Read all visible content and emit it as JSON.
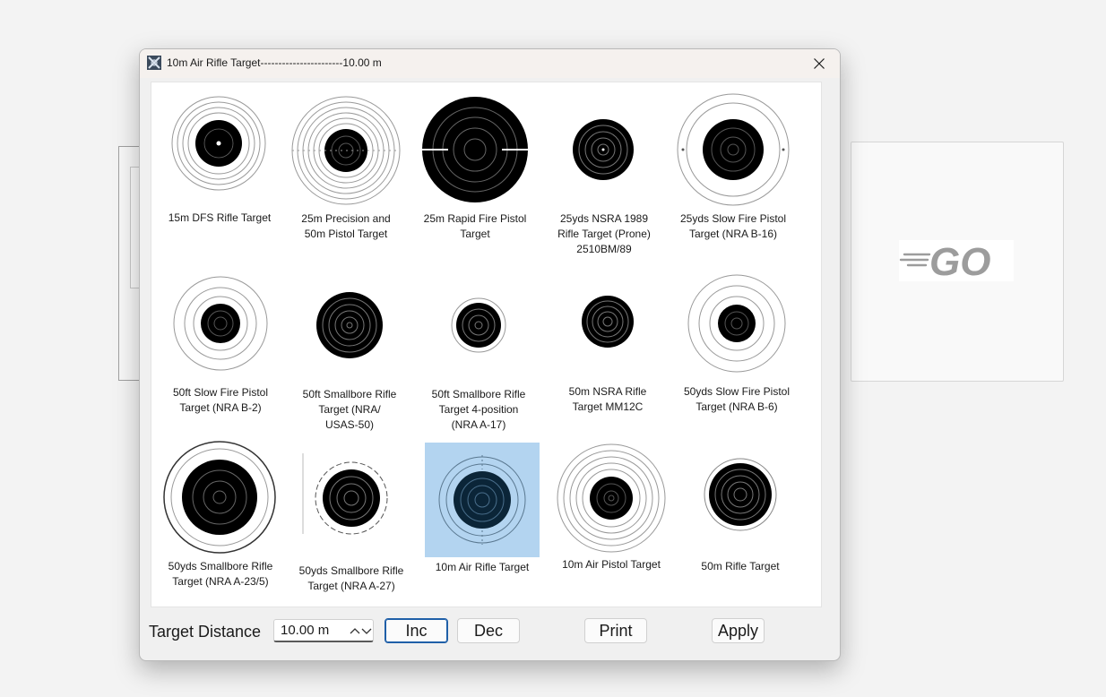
{
  "window": {
    "title": "10m Air Rifle Target-----------------------10.00 m",
    "app_icon": "target-app-icon",
    "close_icon": "close-icon"
  },
  "background": {
    "go_logo_text": "GO"
  },
  "targets": [
    {
      "label": "15m DFS Rifle Target",
      "selected": false
    },
    {
      "label": "25m Precision and\n50m Pistol Target",
      "selected": false
    },
    {
      "label": "25m Rapid Fire Pistol\nTarget",
      "selected": false
    },
    {
      "label": "25yds NSRA 1989\nRifle Target (Prone)\n2510BM/89",
      "selected": false
    },
    {
      "label": "25yds Slow Fire Pistol\nTarget (NRA B-16)",
      "selected": false
    },
    {
      "label": "50ft Slow Fire Pistol\nTarget (NRA B-2)",
      "selected": false
    },
    {
      "label": "50ft Smallbore Rifle\nTarget (NRA/\nUSAS-50)",
      "selected": false
    },
    {
      "label": "50ft Smallbore Rifle\nTarget 4-position\n(NRA A-17)",
      "selected": false
    },
    {
      "label": "50m NSRA Rifle\nTarget MM12C",
      "selected": false
    },
    {
      "label": "50yds Slow Fire Pistol\nTarget (NRA B-6)",
      "selected": false
    },
    {
      "label": "50yds Smallbore Rifle\nTarget (NRA A-23/5)",
      "selected": false
    },
    {
      "label": "50yds Smallbore Rifle\nTarget (NRA A-27)",
      "selected": false
    },
    {
      "label": "10m Air Rifle Target",
      "selected": true
    },
    {
      "label": "10m Air Pistol Target",
      "selected": false
    },
    {
      "label": "50m Rifle Target",
      "selected": false
    }
  ],
  "controls": {
    "distance_label": "Target Distance",
    "distance_value": "10.00 m",
    "inc_label": "Inc",
    "dec_label": "Dec",
    "print_label": "Print",
    "apply_label": "Apply"
  },
  "colors": {
    "selection": "#b3d4f0",
    "focus_border": "#1f5fa8"
  }
}
